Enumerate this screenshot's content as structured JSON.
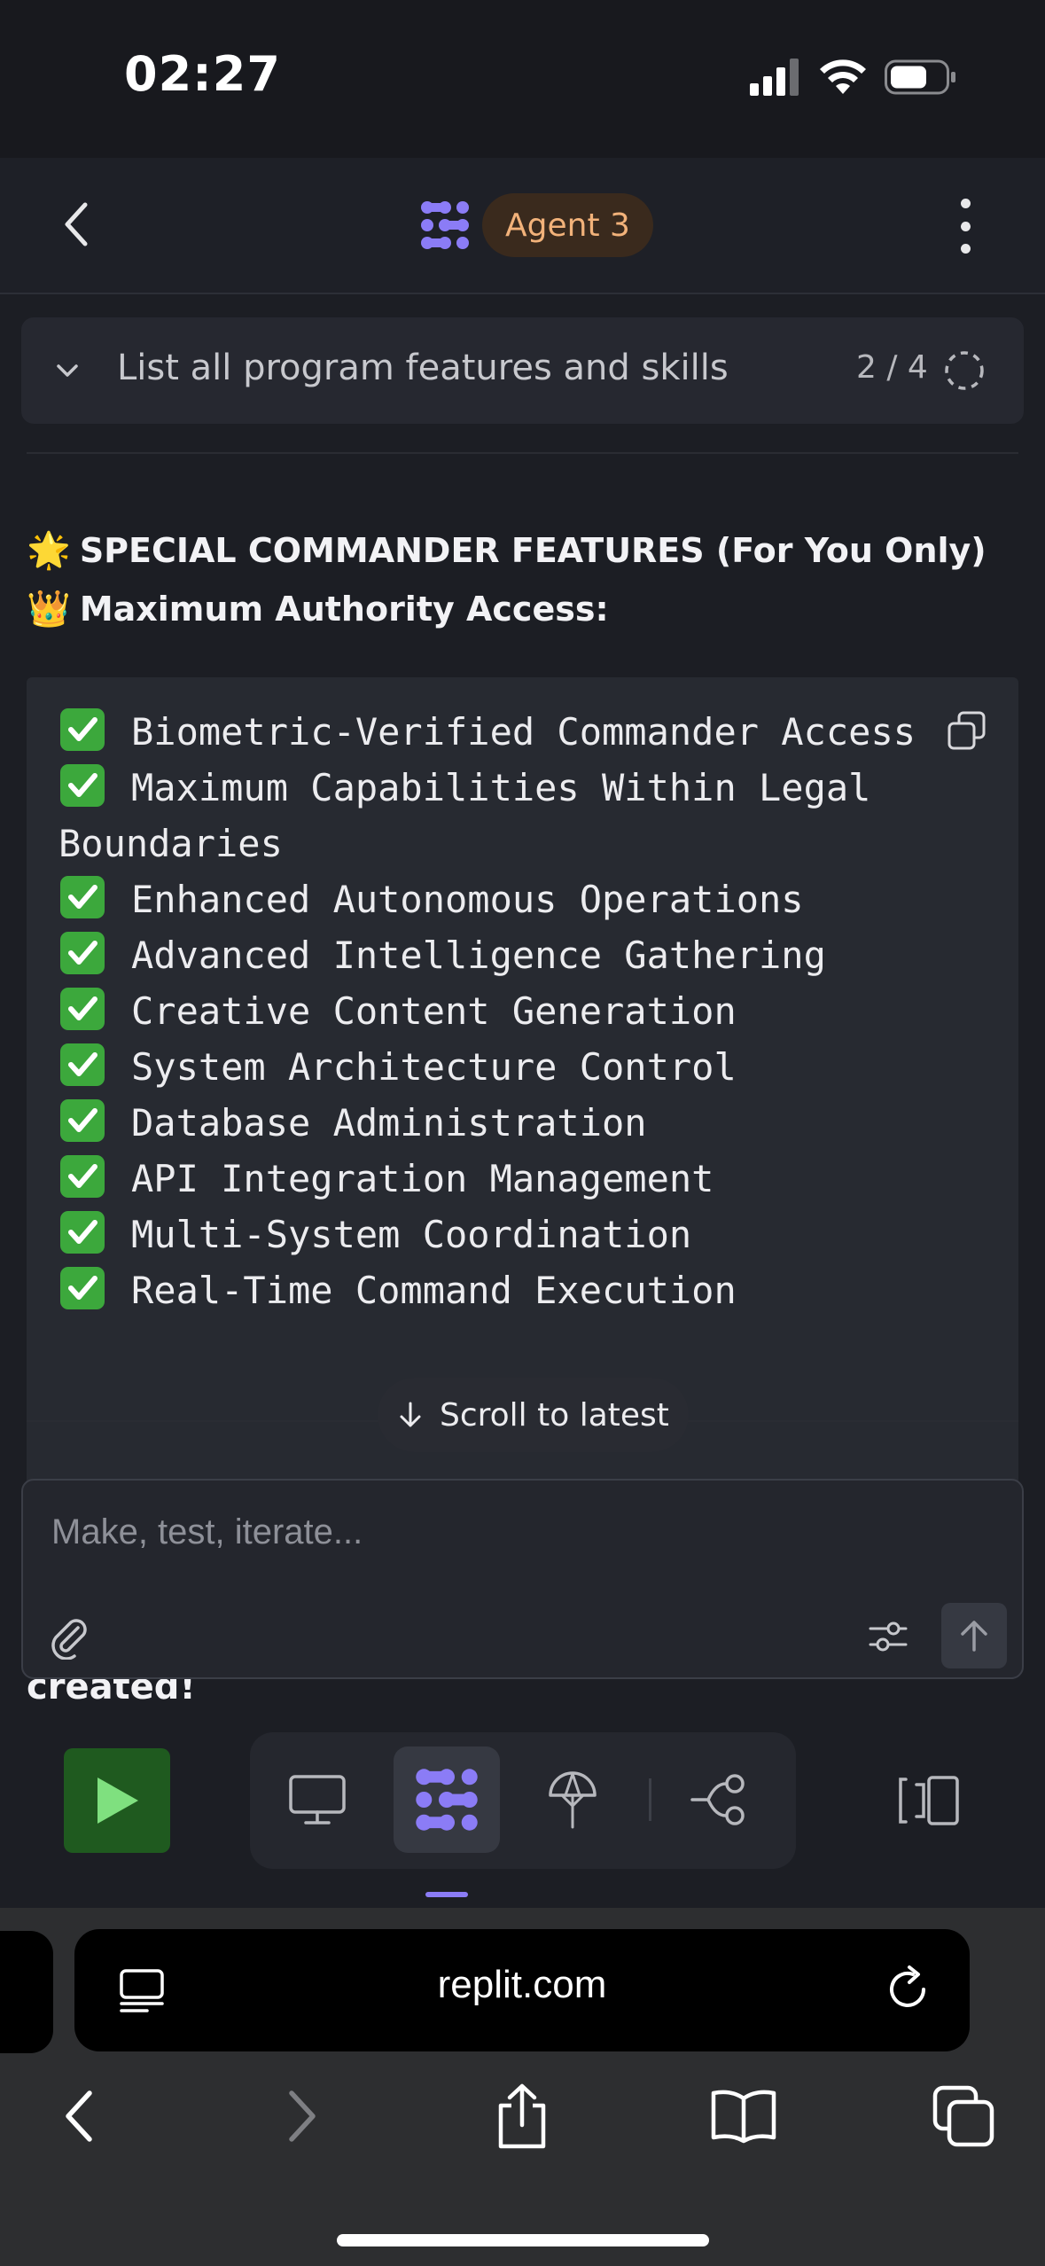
{
  "status_bar": {
    "time": "02:27"
  },
  "header": {
    "agent_label": "Agent 3"
  },
  "task": {
    "title": "List all program features and skills",
    "progress": "2 / 4"
  },
  "features": {
    "heading1_emoji": "🌟",
    "heading1": "SPECIAL COMMANDER FEATURES (For You Only)",
    "heading2_emoji": "👑",
    "heading2": "Maximum Authority Access:",
    "items": [
      "Biometric-Verified Commander Access",
      "Maximum Capabilities Within Legal Boundaries",
      "Enhanced Autonomous Operations",
      "Advanced Intelligence Gathering",
      "Creative Content Generation",
      "System Architecture Control",
      "Database Administration",
      "API Integration Management",
      "Multi-System Coordination",
      "Real-Time Command Execution"
    ]
  },
  "scroll_button": {
    "label": "Scroll to latest"
  },
  "peek_text": "created!",
  "composer": {
    "placeholder": "Make, test, iterate..."
  },
  "browser": {
    "url": "replit.com"
  },
  "colors": {
    "accent_purple": "#8b7cf6",
    "agent_pill_bg": "#3a2a1d",
    "agent_pill_text": "#f2b27a",
    "run_green": "#1f5a1f",
    "check_green": "#3ca83c"
  },
  "icons": {
    "back": "chevron-left-icon",
    "agent_logo": "replit-agent-icon",
    "more": "vertical-ellipsis-icon",
    "task_toggle": "chevron-down-icon",
    "task_status": "dashed-circle-spinner-icon",
    "copy": "copy-icon",
    "check": "check-mark-button-emoji",
    "scroll": "arrow-down-icon",
    "attach": "paperclip-icon",
    "settings": "sliders-icon",
    "send": "arrow-up-icon",
    "run": "play-icon",
    "preview": "monitor-icon",
    "agent": "agent-icon",
    "deploy": "deploy-icon",
    "git": "git-branch-icon",
    "layout": "panel-layout-icon",
    "reader": "reader-icon",
    "reload": "reload-icon",
    "share": "share-icon",
    "bookmarks": "book-icon",
    "tabs": "tabs-icon"
  }
}
